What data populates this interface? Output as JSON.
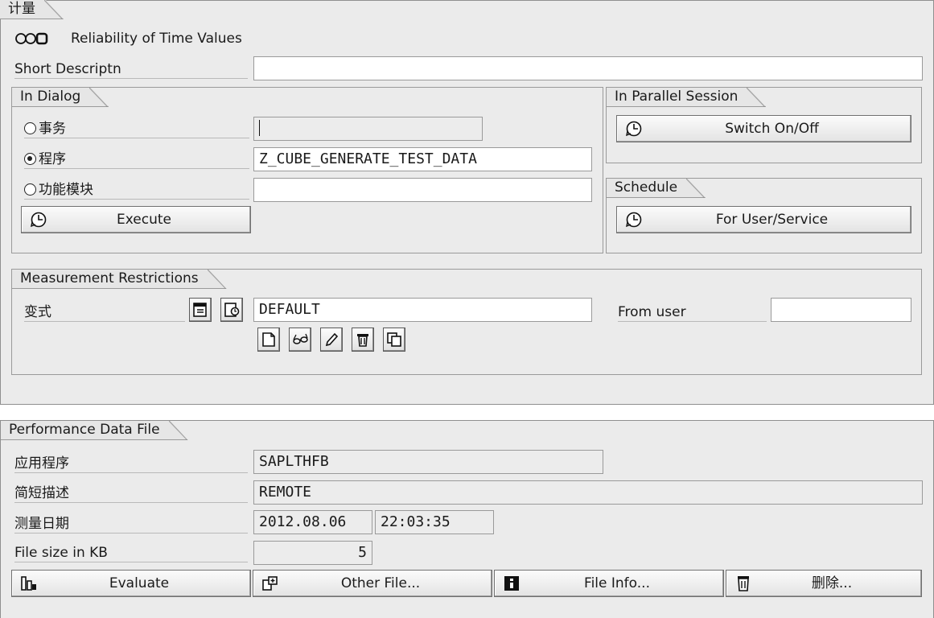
{
  "measure": {
    "tab": "计量",
    "status_text": "Reliability of Time Values",
    "short_desc_label": "Short Descriptn",
    "short_desc_value": "",
    "in_dialog": {
      "tab": "In Dialog",
      "options": [
        {
          "label": "事务",
          "value": "",
          "selected": false
        },
        {
          "label": "程序",
          "value": "Z_CUBE_GENERATE_TEST_DATA",
          "selected": true
        },
        {
          "label": "功能模块",
          "value": "",
          "selected": false
        }
      ],
      "execute_label": "Execute"
    },
    "parallel": {
      "tab": "In Parallel Session",
      "switch_label": "Switch On/Off"
    },
    "schedule": {
      "tab": "Schedule",
      "for_user_label": "For User/Service"
    },
    "restrictions": {
      "tab": "Measurement Restrictions",
      "variant_label": "变式",
      "variant_value": "DEFAULT",
      "from_user_label": "From user",
      "from_user_value": ""
    }
  },
  "perf": {
    "tab": "Performance Data File",
    "rows": {
      "app_label": "应用程序",
      "app_value": "SAPLTHFB",
      "desc_label": "简短描述",
      "desc_value": "REMOTE",
      "date_label": "测量日期",
      "date_value": "2012.08.06",
      "time_value": "22:03:35",
      "size_label": "File size in KB",
      "size_value": "5"
    },
    "buttons": {
      "evaluate": "Evaluate",
      "other_file": "Other File...",
      "file_info": "File Info...",
      "delete": "删除..."
    }
  },
  "icons": {
    "clock": "clock-icon",
    "status": "status-lights-icon"
  }
}
